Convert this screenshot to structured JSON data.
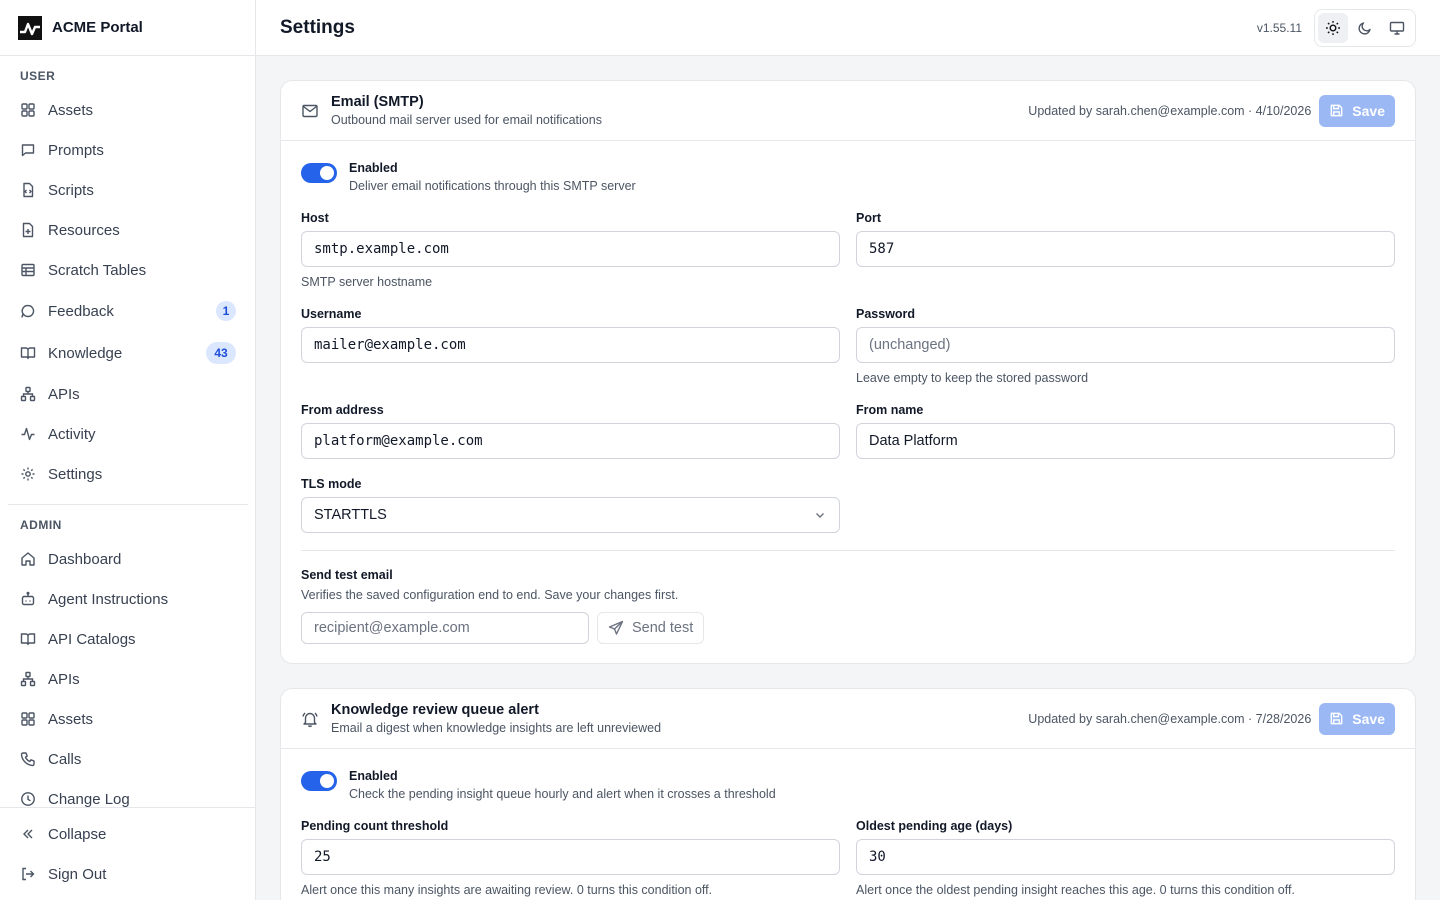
{
  "app": {
    "name": "ACME Portal"
  },
  "sidebar": {
    "user_label": "USER",
    "admin_label": "ADMIN",
    "user_items": [
      {
        "label": "Assets",
        "icon": "grid-icon"
      },
      {
        "label": "Prompts",
        "icon": "message-square-icon"
      },
      {
        "label": "Scripts",
        "icon": "file-code-icon"
      },
      {
        "label": "Resources",
        "icon": "file-plus-icon"
      },
      {
        "label": "Scratch Tables",
        "icon": "table-icon"
      },
      {
        "label": "Feedback",
        "icon": "message-circle-icon",
        "badge": "1"
      },
      {
        "label": "Knowledge",
        "icon": "book-open-icon",
        "badge": "43"
      },
      {
        "label": "APIs",
        "icon": "network-icon"
      },
      {
        "label": "Activity",
        "icon": "activity-icon"
      },
      {
        "label": "Settings",
        "icon": "gear-icon"
      }
    ],
    "admin_items": [
      {
        "label": "Dashboard",
        "icon": "home-icon"
      },
      {
        "label": "Agent Instructions",
        "icon": "bot-icon"
      },
      {
        "label": "API Catalogs",
        "icon": "book-open-icon"
      },
      {
        "label": "APIs",
        "icon": "network-icon"
      },
      {
        "label": "Assets",
        "icon": "grid-icon"
      },
      {
        "label": "Calls",
        "icon": "phone-icon"
      },
      {
        "label": "Change Log",
        "icon": "clock-icon"
      }
    ],
    "collapse_label": "Collapse",
    "signout_label": "Sign Out"
  },
  "header": {
    "title": "Settings",
    "version": "v1.55.11",
    "theme_active": "light"
  },
  "smtp_card": {
    "title": "Email (SMTP)",
    "subtitle": "Outbound mail server used for email notifications",
    "updated": "Updated by sarah.chen@example.com · 4/10/2026",
    "save_label": "Save",
    "enabled_title": "Enabled",
    "enabled_sub": "Deliver email notifications through this SMTP server",
    "enabled": true,
    "host_label": "Host",
    "host_value": "smtp.example.com",
    "host_help": "SMTP server hostname",
    "port_label": "Port",
    "port_value": "587",
    "username_label": "Username",
    "username_value": "mailer@example.com",
    "password_label": "Password",
    "password_placeholder": "(unchanged)",
    "password_help": "Leave empty to keep the stored password",
    "from_address_label": "From address",
    "from_address_value": "platform@example.com",
    "from_name_label": "From name",
    "from_name_value": "Data Platform",
    "tls_label": "TLS mode",
    "tls_value": "STARTTLS",
    "test_title": "Send test email",
    "test_sub": "Verifies the saved configuration end to end. Save your changes first.",
    "test_placeholder": "recipient@example.com",
    "test_button": "Send test"
  },
  "kr_card": {
    "title": "Knowledge review queue alert",
    "subtitle": "Email a digest when knowledge insights are left unreviewed",
    "updated": "Updated by sarah.chen@example.com · 7/28/2026",
    "save_label": "Save",
    "enabled_title": "Enabled",
    "enabled_sub": "Check the pending insight queue hourly and alert when it crosses a threshold",
    "enabled": true,
    "pending_label": "Pending count threshold",
    "pending_value": "25",
    "pending_help": "Alert once this many insights are awaiting review. 0 turns this condition off.",
    "age_label": "Oldest pending age (days)",
    "age_value": "30",
    "age_help": "Alert once the oldest pending insight reaches this age. 0 turns this condition off."
  },
  "colors": {
    "accent": "#2563eb",
    "save_disabled": "#9bb8f5",
    "badge_bg": "#dbe6ff"
  }
}
